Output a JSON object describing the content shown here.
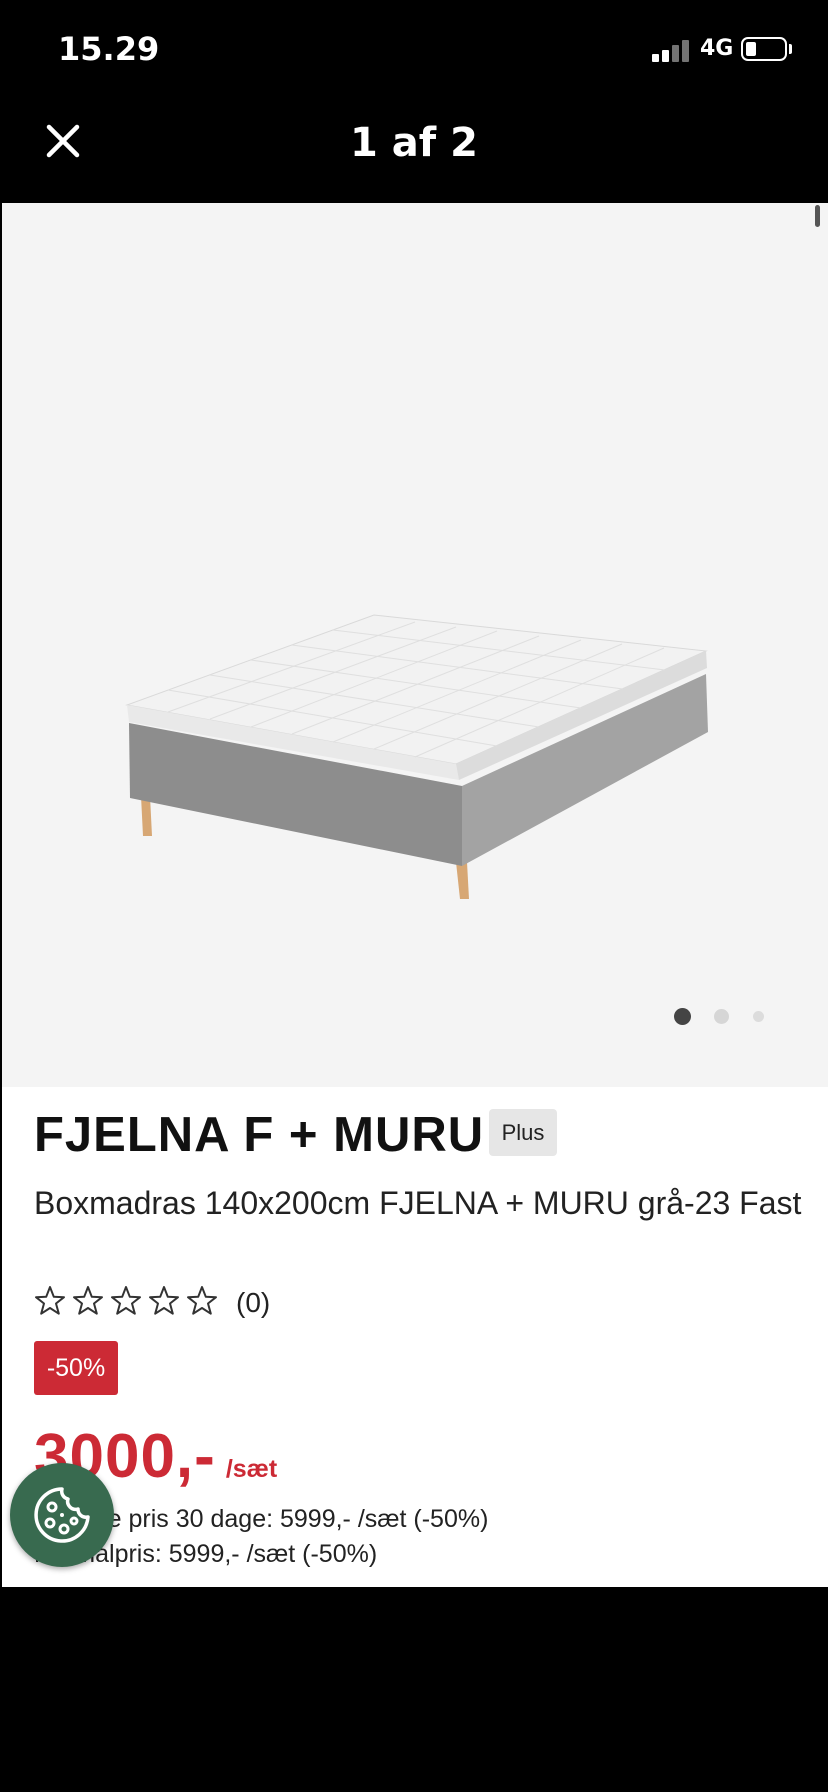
{
  "status_bar": {
    "time": "15.29",
    "network": "4G"
  },
  "viewer": {
    "title": "1 af 2"
  },
  "gallery": {
    "dots_total": 3,
    "active_dot": 1
  },
  "product": {
    "title": "FJELNA F + MURU",
    "badge": "Plus",
    "subtitle": "Boxmadras 140x200cm FJELNA + MURU grå-23 Fast",
    "rating": {
      "stars_total": 5,
      "stars_filled": 0,
      "count": "(0)"
    },
    "discount": "-50%",
    "price": "3000,-",
    "price_unit": "/sæt",
    "lowest_price_line": "Laveste pris 30 dage: 5999,- /sæt (-50%)",
    "normal_price_line": "Normalpris: 5999,- /sæt (-50%)"
  },
  "colors": {
    "accent": "#cc2a35",
    "cookie_button": "#386a4f",
    "gallery_bg": "#f4f4f4"
  },
  "icons": {
    "close": "close-icon",
    "cookie": "cookie-icon",
    "star": "star-outline-icon"
  }
}
